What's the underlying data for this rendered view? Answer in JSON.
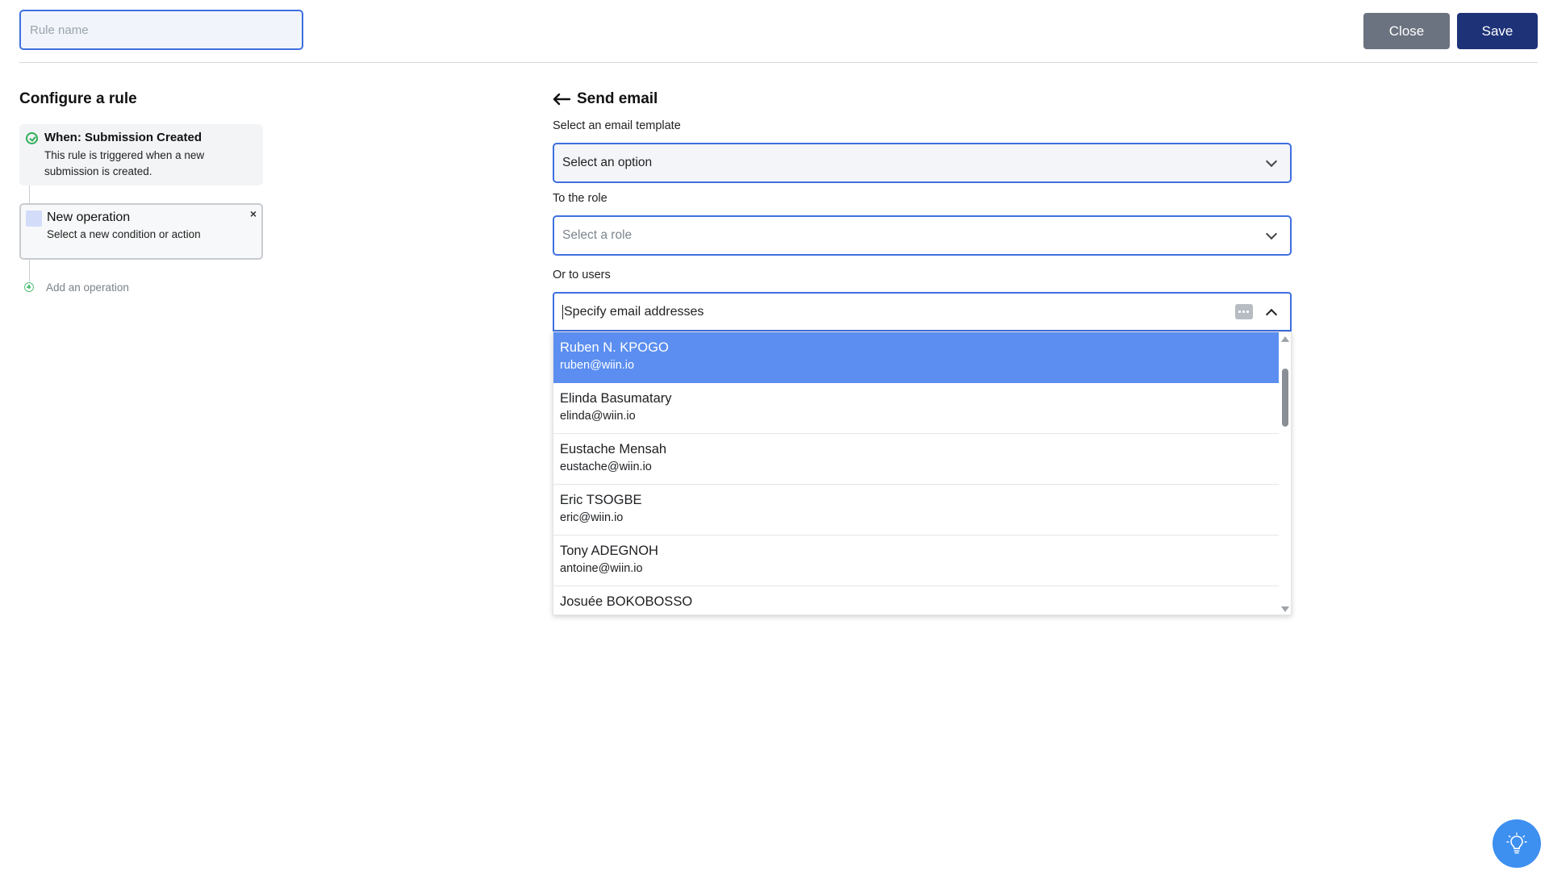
{
  "header": {
    "rule_name_placeholder": "Rule name",
    "close_label": "Close",
    "save_label": "Save"
  },
  "left_panel": {
    "title": "Configure a rule",
    "trigger": {
      "title": "When: Submission Created",
      "description": "This rule is triggered when a new submission is created."
    },
    "operation": {
      "title": "New operation",
      "description": "Select a new condition or action",
      "close_symbol": "×"
    },
    "add_operation_label": "Add an operation"
  },
  "right_panel": {
    "title": "Send email",
    "template": {
      "label": "Select an email template",
      "value": "Select an option"
    },
    "role": {
      "label": "To the role",
      "placeholder": "Select a role"
    },
    "users": {
      "label": "Or to users",
      "placeholder": "Specify email addresses",
      "options": [
        {
          "name": "Ruben N. KPOGO",
          "email": "ruben@wiin.io"
        },
        {
          "name": "Elinda Basumatary",
          "email": "elinda@wiin.io"
        },
        {
          "name": "Eustache Mensah",
          "email": "eustache@wiin.io"
        },
        {
          "name": "Eric TSOGBE",
          "email": "eric@wiin.io"
        },
        {
          "name": "Tony ADEGNOH",
          "email": "antoine@wiin.io"
        },
        {
          "name": "Josuée BOKOBOSSO",
          "email": ""
        }
      ]
    }
  },
  "colors": {
    "accent": "#3f6fe0",
    "save_button": "#1e3278",
    "close_button": "#6b7380",
    "active_option": "#5b8ef0",
    "success": "#2fae58",
    "help_button": "#3d8ff0"
  },
  "icons": {
    "back": "arrow-left-icon",
    "trigger": "check-circle-icon",
    "add": "plus-circle-icon",
    "keyboard": "keyboard-icon",
    "help": "lightbulb-icon"
  }
}
